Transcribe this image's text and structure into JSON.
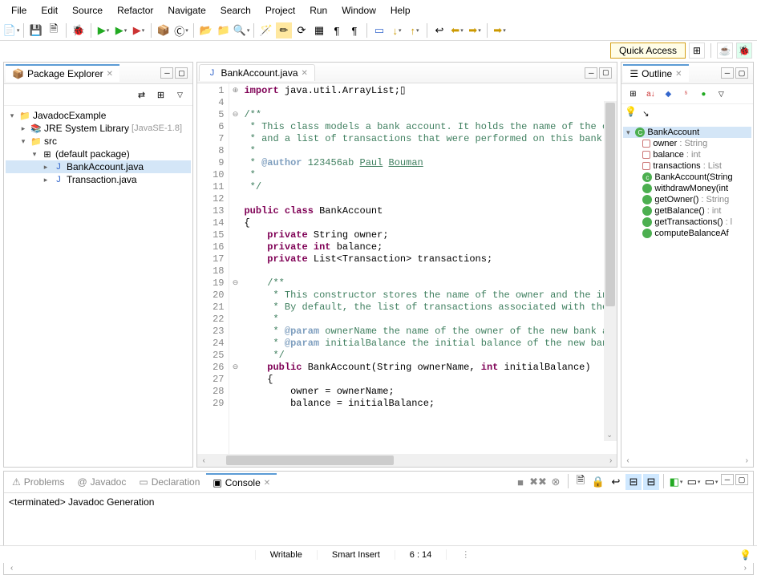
{
  "menu": [
    "File",
    "Edit",
    "Source",
    "Refactor",
    "Navigate",
    "Search",
    "Project",
    "Run",
    "Window",
    "Help"
  ],
  "quick_access": "Quick Access",
  "package_explorer": {
    "title": "Package Explorer",
    "project": "JavadocExample",
    "jre": "JRE System Library",
    "jre_decoration": "[JavaSE-1.8]",
    "src": "src",
    "pkg": "(default package)",
    "files": [
      "BankAccount.java",
      "Transaction.java"
    ]
  },
  "editor": {
    "tab": "BankAccount.java",
    "lines": [
      {
        "n": 1,
        "fold": "⊕",
        "html": "<span class='kw'>import</span> java.util.ArrayList;▯"
      },
      {
        "n": 4,
        "fold": "",
        "html": ""
      },
      {
        "n": 5,
        "fold": "⊖",
        "html": "<span class='comment'>/**</span>"
      },
      {
        "n": 6,
        "fold": "",
        "html": "<span class='comment'> * This class models a bank account. It holds the name of the ow</span>"
      },
      {
        "n": 7,
        "fold": "",
        "html": "<span class='comment'> * and a list of transactions that were performed on this bank a</span>"
      },
      {
        "n": 8,
        "fold": "",
        "html": "<span class='comment'> * </span>"
      },
      {
        "n": 9,
        "fold": "",
        "html": "<span class='comment'> * <span class='doctag'>@author</span> 123456ab <u>Paul</u> <u>Bouman</u></span>"
      },
      {
        "n": 10,
        "fold": "",
        "html": "<span class='comment'> *</span>"
      },
      {
        "n": 11,
        "fold": "",
        "html": "<span class='comment'> */</span>"
      },
      {
        "n": 12,
        "fold": "",
        "html": ""
      },
      {
        "n": 13,
        "fold": "",
        "html": "<span class='kw'>public</span> <span class='kw'>class</span> BankAccount"
      },
      {
        "n": 14,
        "fold": "",
        "html": "{"
      },
      {
        "n": 15,
        "fold": "",
        "html": "    <span class='kw'>private</span> String owner;"
      },
      {
        "n": 16,
        "fold": "",
        "html": "    <span class='kw'>private</span> <span class='kw'>int</span> balance;"
      },
      {
        "n": 17,
        "fold": "",
        "html": "    <span class='kw'>private</span> List&lt;Transaction&gt; transactions;"
      },
      {
        "n": 18,
        "fold": "",
        "html": ""
      },
      {
        "n": 19,
        "fold": "⊖",
        "html": "    <span class='comment'>/**</span>"
      },
      {
        "n": 20,
        "fold": "",
        "html": "    <span class='comment'> * This constructor stores the name of the owner and the ini</span>"
      },
      {
        "n": 21,
        "fold": "",
        "html": "    <span class='comment'> * By default, the list of transactions associated with the </span>"
      },
      {
        "n": 22,
        "fold": "",
        "html": "    <span class='comment'> * </span>"
      },
      {
        "n": 23,
        "fold": "",
        "html": "    <span class='comment'> * <span class='doctag'>@param</span> ownerName the name of the owner of the new bank ac</span>"
      },
      {
        "n": 24,
        "fold": "",
        "html": "    <span class='comment'> * <span class='doctag'>@param</span> initialBalance the initial balance of the new bank</span>"
      },
      {
        "n": 25,
        "fold": "",
        "html": "    <span class='comment'> */</span>"
      },
      {
        "n": 26,
        "fold": "⊖",
        "html": "    <span class='kw'>public</span> BankAccount(String ownerName, <span class='kw'>int</span> initialBalance)"
      },
      {
        "n": 27,
        "fold": "",
        "html": "    {"
      },
      {
        "n": 28,
        "fold": "",
        "html": "        owner = ownerName;"
      },
      {
        "n": 29,
        "fold": "",
        "html": "        balance = initialBalance;"
      }
    ]
  },
  "outline": {
    "title": "Outline",
    "class": "BankAccount",
    "members": [
      {
        "icon": "field",
        "label": "owner",
        "type": ": String"
      },
      {
        "icon": "field",
        "label": "balance",
        "type": ": int"
      },
      {
        "icon": "field",
        "label": "transactions",
        "type": ": List<T"
      },
      {
        "icon": "constructor",
        "label": "BankAccount(String",
        "type": ""
      },
      {
        "icon": "method",
        "label": "withdrawMoney(int",
        "type": ""
      },
      {
        "icon": "method",
        "label": "getOwner()",
        "type": ": String"
      },
      {
        "icon": "method",
        "label": "getBalance()",
        "type": ": int"
      },
      {
        "icon": "method",
        "label": "getTransactions()",
        "type": ": l"
      },
      {
        "icon": "method",
        "label": "computeBalanceAf",
        "type": ""
      }
    ]
  },
  "bottom": {
    "tabs": [
      "Problems",
      "Javadoc",
      "Declaration",
      "Console"
    ],
    "active": 3,
    "console_text": "<terminated> Javadoc Generation"
  },
  "status": {
    "writable": "Writable",
    "insert": "Smart Insert",
    "pos": "6 : 14"
  }
}
